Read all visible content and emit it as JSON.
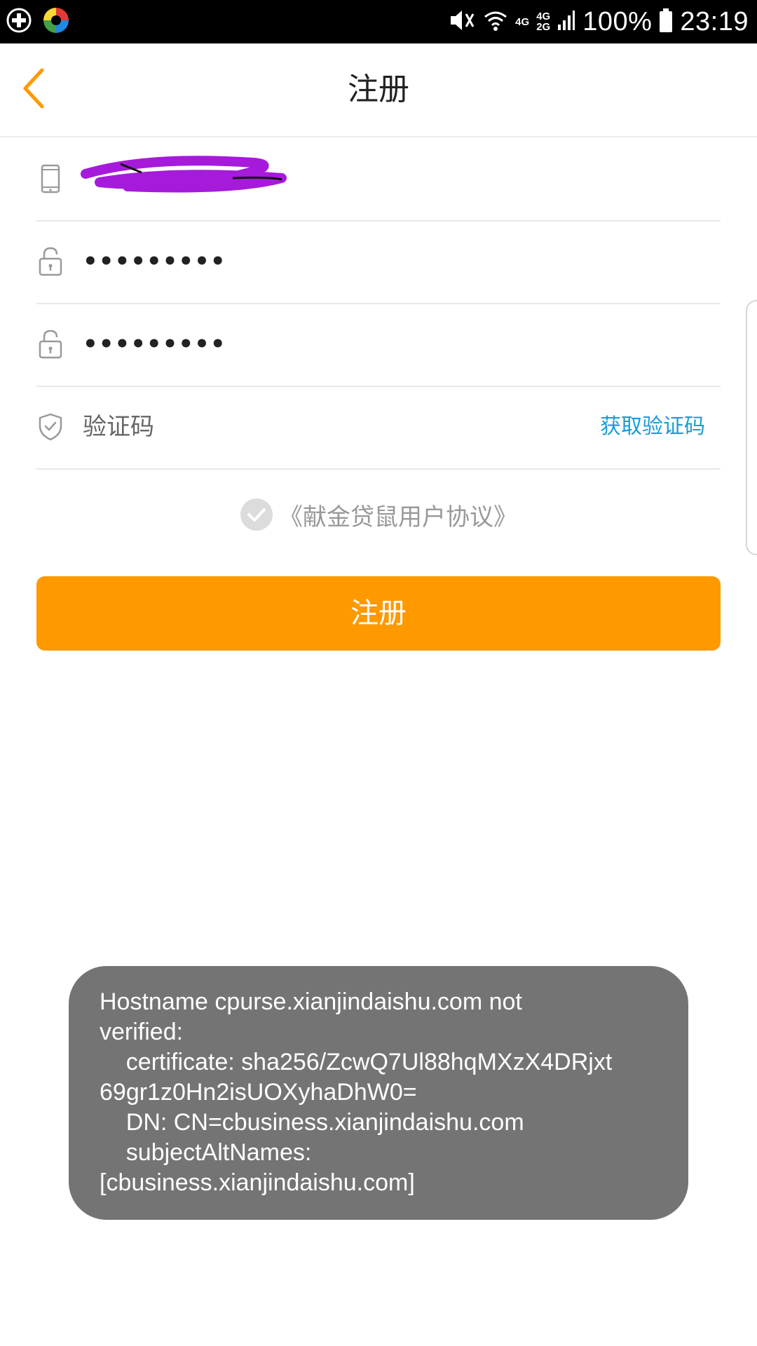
{
  "status_bar": {
    "network_top": "4G",
    "network_dual_top": "4G",
    "network_dual_bottom": "2G",
    "battery": "100%",
    "time": "23:19",
    "icons": [
      "app-cross-icon",
      "color-ball-icon",
      "mute-icon",
      "wifi-icon",
      "signal-icon",
      "battery-icon"
    ]
  },
  "header": {
    "title": "注册",
    "back_icon": "chevron-left-icon",
    "accent_color": "#ff9900"
  },
  "form": {
    "phone": {
      "icon": "phone-icon",
      "value": "",
      "redacted": true
    },
    "password": {
      "icon": "lock-icon",
      "value": "•••••••••"
    },
    "confirm_password": {
      "icon": "lock-icon",
      "value": "•••••••••"
    },
    "verification": {
      "icon": "shield-icon",
      "placeholder": "验证码",
      "get_code_label": "获取验证码"
    }
  },
  "agreement": {
    "text": "《献金贷鼠用户协议》",
    "checked": true
  },
  "submit": {
    "label": "注册",
    "color": "#ff9900"
  },
  "toast": {
    "lines": [
      "Hostname cpurse.xianjindaishu.com not",
      "verified:",
      "    certificate: sha256/ZcwQ7Ul88hqMXzX4DRjxt",
      "69gr1z0Hn2isUOXyhaDhW0=",
      "    DN: CN=cbusiness.xianjindaishu.com",
      "    subjectAltNames:",
      "[cbusiness.xianjindaishu.com]"
    ]
  }
}
